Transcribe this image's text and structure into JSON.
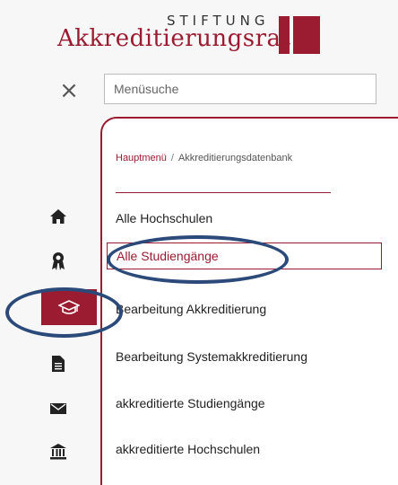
{
  "logo": {
    "top": "STIFTUNG",
    "name": "Akkreditierungsrat"
  },
  "search": {
    "placeholder": "Menüsuche"
  },
  "breadcrumb": {
    "home": "Hauptmenü",
    "separator": "/",
    "current": "Akkreditierungsdatenbank"
  },
  "menu": {
    "items": [
      {
        "label": "Alle Hochschulen"
      },
      {
        "label": "Alle Studiengänge"
      },
      {
        "label": "Bearbeitung Akkreditierung"
      },
      {
        "label": "Bearbeitung Systemakkreditierung"
      },
      {
        "label": "akkreditierte Studiengänge"
      },
      {
        "label": "akkreditierte Hochschulen"
      }
    ],
    "selected_index": 1
  },
  "rail": {
    "icons": [
      "home-icon",
      "award-icon",
      "graduation-cap-icon",
      "document-icon",
      "envelope-icon",
      "institution-icon"
    ],
    "active_icon": "graduation-cap-icon"
  },
  "colors": {
    "accent": "#9b1b30",
    "annotation": "#2b4a7a"
  }
}
